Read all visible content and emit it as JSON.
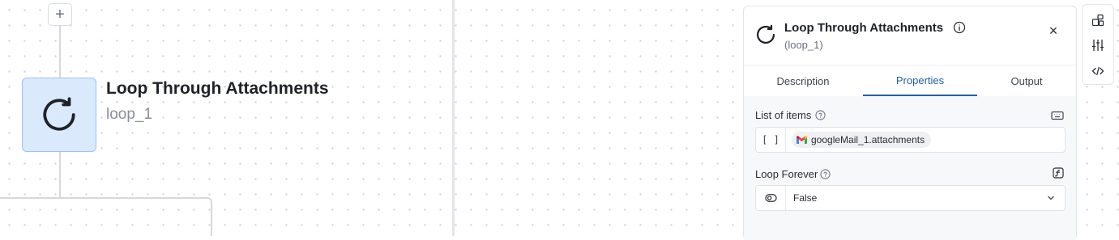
{
  "canvas": {
    "add_label": "+",
    "node": {
      "title": "Loop Through Attachments",
      "id": "loop_1"
    }
  },
  "panel": {
    "title": "Loop Through Attachments",
    "subtitle": "(loop_1)",
    "close_label": "×",
    "tabs": [
      {
        "label": "Description",
        "active": false
      },
      {
        "label": "Properties",
        "active": true
      },
      {
        "label": "Output",
        "active": false
      }
    ],
    "fields": {
      "list_of_items": {
        "label": "List of items",
        "prefix": "[ ]",
        "chip_value": "googleMail_1.attachments"
      },
      "loop_forever": {
        "label": "Loop Forever",
        "value": "False"
      }
    }
  },
  "colors": {
    "node_fill": "#dbe9fd",
    "node_border": "#9cc3f3",
    "accent": "#1f5fa8",
    "gmail_red": "#ea4335"
  },
  "icons": [
    "plus-icon",
    "loop-icon",
    "info-icon",
    "close-icon",
    "help-icon",
    "keyboard-icon",
    "function-icon",
    "eye-icon",
    "chevron-down-icon",
    "gmail-icon",
    "layout-icon",
    "sliders-icon",
    "code-icon"
  ]
}
